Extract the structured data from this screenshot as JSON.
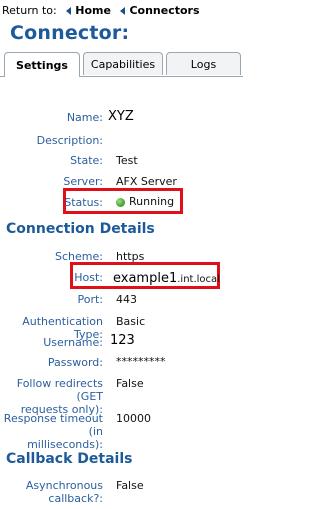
{
  "breadcrumb": {
    "prefix": "Return to:",
    "items": [
      "Home",
      "Connectors"
    ]
  },
  "page": {
    "title": "Connector:"
  },
  "tabs": [
    {
      "label": "Settings",
      "active": true
    },
    {
      "label": "Capabilities",
      "active": false
    },
    {
      "label": "Logs",
      "active": false
    }
  ],
  "fields": {
    "name": {
      "label": "Name:",
      "value": "XYZ"
    },
    "description": {
      "label": "Description:",
      "value": ""
    },
    "state": {
      "label": "State:",
      "value": "Test"
    },
    "server": {
      "label": "Server:",
      "value": "AFX Server"
    },
    "status": {
      "label": "Status:",
      "value": "Running"
    }
  },
  "connection": {
    "title": "Connection Details",
    "scheme": {
      "label": "Scheme:",
      "value": "https"
    },
    "host": {
      "label": "Host:",
      "value_main": "example1",
      "value_suffix": ".int.local"
    },
    "port": {
      "label": "Port:",
      "value": "443"
    },
    "auth_type": {
      "label": "Authentication Type:",
      "value": "Basic"
    },
    "username": {
      "label": "Username:",
      "value": "123"
    },
    "password": {
      "label": "Password:",
      "value": "*********"
    },
    "follow_redirects": {
      "label_line1": "Follow redirects (GET",
      "label_line2": "requests only):",
      "value": "False"
    },
    "timeout": {
      "label_line1": "Response timeout (in",
      "label_line2": "milliseconds):",
      "value": "10000"
    }
  },
  "callback": {
    "title": "Callback Details",
    "asynchronous": {
      "label_line1": "Asynchronous",
      "label_line2": "callback?:",
      "value": "False"
    }
  },
  "colors": {
    "accent": "#1d5a9a",
    "label": "#2a5f9e",
    "highlight": "#e0101a",
    "status_ok": "#3c9a2c"
  }
}
